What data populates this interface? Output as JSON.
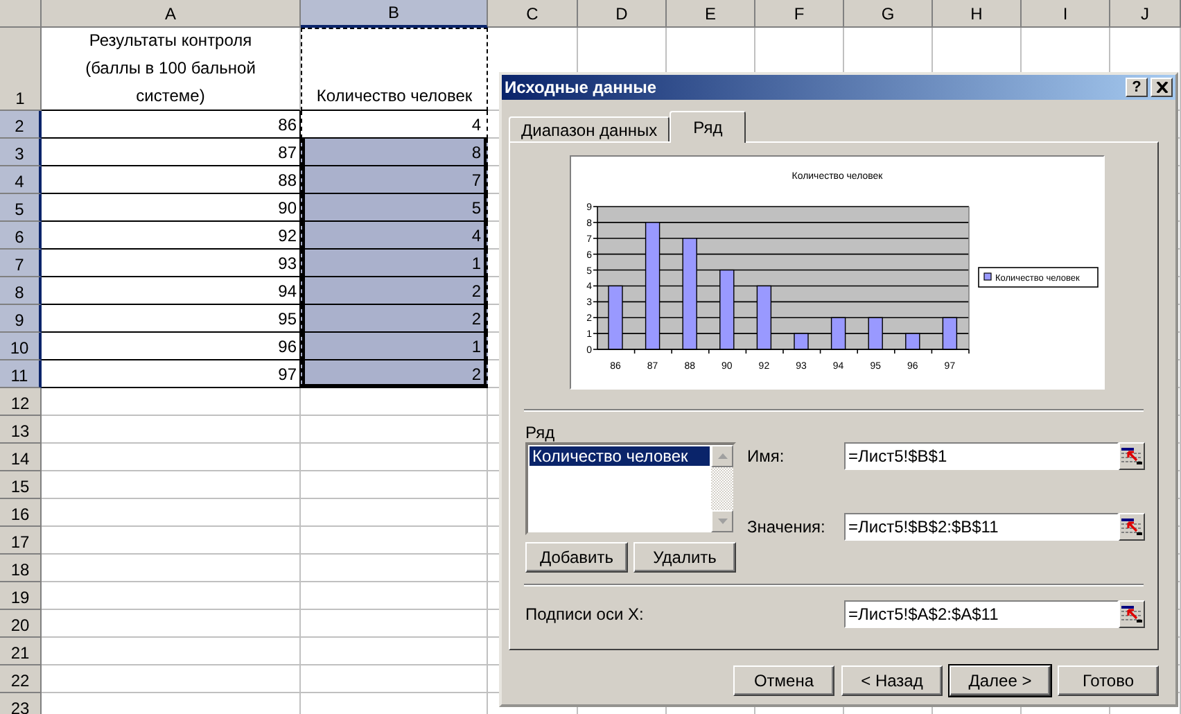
{
  "spreadsheet": {
    "marquee": true,
    "columns": [
      {
        "label": "A",
        "selected": false
      },
      {
        "label": "B",
        "selected": true
      },
      {
        "label": "C",
        "selected": false
      },
      {
        "label": "D",
        "selected": false
      },
      {
        "label": "E",
        "selected": false
      },
      {
        "label": "F",
        "selected": false
      },
      {
        "label": "G",
        "selected": false
      },
      {
        "label": "H",
        "selected": false
      },
      {
        "label": "I",
        "selected": false
      },
      {
        "label": "J",
        "selected": false
      }
    ],
    "rows": [
      {
        "label": "1",
        "selected": false,
        "cells": [
          {
            "kind": "text",
            "text": "Результаты контроля (баллы в 100 бальной системе)",
            "selected": false
          },
          {
            "kind": "text",
            "text": "Количество человек",
            "selected": false
          }
        ]
      },
      {
        "label": "2",
        "selected": true,
        "cells": [
          {
            "kind": "number",
            "text": "86",
            "selected": false
          },
          {
            "kind": "number",
            "text": "4",
            "selected": false
          }
        ]
      },
      {
        "label": "3",
        "selected": true,
        "cells": [
          {
            "kind": "number",
            "text": "87",
            "selected": false
          },
          {
            "kind": "number",
            "text": "8",
            "selected": true
          }
        ]
      },
      {
        "label": "4",
        "selected": true,
        "cells": [
          {
            "kind": "number",
            "text": "88",
            "selected": false
          },
          {
            "kind": "number",
            "text": "7",
            "selected": true
          }
        ]
      },
      {
        "label": "5",
        "selected": true,
        "cells": [
          {
            "kind": "number",
            "text": "90",
            "selected": false
          },
          {
            "kind": "number",
            "text": "5",
            "selected": true
          }
        ]
      },
      {
        "label": "6",
        "selected": true,
        "cells": [
          {
            "kind": "number",
            "text": "92",
            "selected": false
          },
          {
            "kind": "number",
            "text": "4",
            "selected": true
          }
        ]
      },
      {
        "label": "7",
        "selected": true,
        "cells": [
          {
            "kind": "number",
            "text": "93",
            "selected": false
          },
          {
            "kind": "number",
            "text": "1",
            "selected": true
          }
        ]
      },
      {
        "label": "8",
        "selected": true,
        "cells": [
          {
            "kind": "number",
            "text": "94",
            "selected": false
          },
          {
            "kind": "number",
            "text": "2",
            "selected": true
          }
        ]
      },
      {
        "label": "9",
        "selected": true,
        "cells": [
          {
            "kind": "number",
            "text": "95",
            "selected": false
          },
          {
            "kind": "number",
            "text": "2",
            "selected": true
          }
        ]
      },
      {
        "label": "10",
        "selected": true,
        "cells": [
          {
            "kind": "number",
            "text": "96",
            "selected": false
          },
          {
            "kind": "number",
            "text": "1",
            "selected": true
          }
        ]
      },
      {
        "label": "11",
        "selected": true,
        "cells": [
          {
            "kind": "number",
            "text": "97",
            "selected": false
          },
          {
            "kind": "number",
            "text": "2",
            "selected": true
          }
        ]
      },
      {
        "label": "12",
        "selected": false
      },
      {
        "label": "13",
        "selected": false
      },
      {
        "label": "14",
        "selected": false
      },
      {
        "label": "15",
        "selected": false
      },
      {
        "label": "16",
        "selected": false
      },
      {
        "label": "17",
        "selected": false
      },
      {
        "label": "18",
        "selected": false
      },
      {
        "label": "19",
        "selected": false
      },
      {
        "label": "20",
        "selected": false
      },
      {
        "label": "21",
        "selected": false
      },
      {
        "label": "22",
        "selected": false
      },
      {
        "label": "23",
        "selected": false
      }
    ]
  },
  "dialog": {
    "title": "Исходные данные",
    "help_button": "?",
    "tabs": [
      {
        "label": "Диапазон данных",
        "selected": false
      },
      {
        "label": "Ряд",
        "selected": true
      }
    ],
    "chart_data": {
      "type": "bar",
      "title": "Количество человек",
      "categories": [
        "86",
        "87",
        "88",
        "90",
        "92",
        "93",
        "94",
        "95",
        "96",
        "97"
      ],
      "series": [
        {
          "name": "Количество человек",
          "color": "#9999ff",
          "values": [
            4,
            8,
            7,
            5,
            4,
            1,
            2,
            2,
            1,
            2
          ]
        }
      ],
      "ylim": [
        0,
        9
      ],
      "yticks": [
        0,
        1,
        2,
        3,
        4,
        5,
        6,
        7,
        8,
        9
      ],
      "grid": true
    },
    "series_label": "Ряд",
    "series_list": [
      {
        "label": "Количество человек",
        "selected": true
      }
    ],
    "add_button": "Добавить",
    "remove_button": "Удалить",
    "fields": [
      {
        "label": "Имя:",
        "value": "=Лист5!$B$1"
      },
      {
        "label": "Значения:",
        "value": "=Лист5!$B$2:$B$11"
      }
    ],
    "x_labels_field": {
      "label": "Подписи оси X:",
      "value": "=Лист5!$A$2:$A$11"
    },
    "buttons": [
      {
        "label": "Отмена",
        "default": false
      },
      {
        "label": "< Назад",
        "default": false
      },
      {
        "label": "Далее >",
        "default": true
      },
      {
        "label": "Готово",
        "default": false
      }
    ]
  }
}
